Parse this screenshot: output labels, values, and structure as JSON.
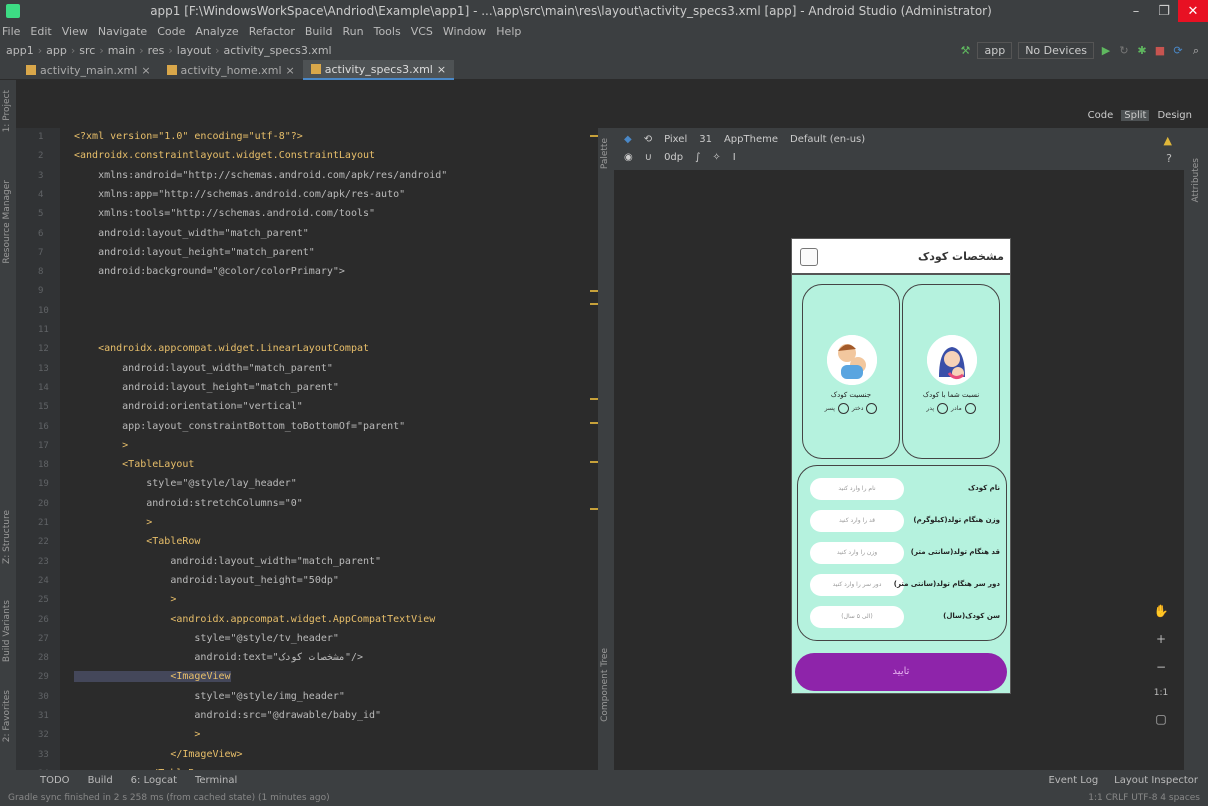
{
  "window": {
    "title": "app1 [F:\\WindowsWorkSpace\\Andriod\\Example\\app1] - ...\\app\\src\\main\\res\\layout\\activity_specs3.xml [app] - Android Studio (Administrator)",
    "minimize": "–",
    "maximize": "❐",
    "close": "✕"
  },
  "menu": [
    "File",
    "Edit",
    "View",
    "Navigate",
    "Code",
    "Analyze",
    "Refactor",
    "Build",
    "Run",
    "Tools",
    "VCS",
    "Window",
    "Help"
  ],
  "breadcrumbs": [
    "app1",
    "app",
    "src",
    "main",
    "res",
    "layout",
    "activity_specs3.xml"
  ],
  "run": {
    "config": "app",
    "device": "No Devices"
  },
  "tabs": [
    "activity_main.xml",
    "activity_home.xml",
    "activity_specs3.xml"
  ],
  "viewmode": {
    "code": "Code",
    "split": "Split",
    "design": "Design"
  },
  "designer": {
    "device": "Pixel",
    "api": "31",
    "theme": "AppTheme",
    "locale": "Default (en-us)",
    "margin": "0dp"
  },
  "sidebar": {
    "project": "1: Project",
    "resource": "Resource Manager",
    "structure": "Z: Structure",
    "variants": "Build Variants",
    "favorites": "2: Favorites",
    "palette": "Palette",
    "tree": "Component Tree",
    "attributes": "Attributes"
  },
  "code_lines": [
    "<?xml version=\"1.0\" encoding=\"utf-8\"?>",
    "<androidx.constraintlayout.widget.ConstraintLayout",
    "    xmlns:android=\"http://schemas.android.com/apk/res/android\"",
    "    xmlns:app=\"http://schemas.android.com/apk/res-auto\"",
    "    xmlns:tools=\"http://schemas.android.com/tools\"",
    "    android:layout_width=\"match_parent\"",
    "    android:layout_height=\"match_parent\"",
    "    android:background=\"@color/colorPrimary\">",
    "",
    "",
    "",
    "    <androidx.appcompat.widget.LinearLayoutCompat",
    "        android:layout_width=\"match_parent\"",
    "        android:layout_height=\"match_parent\"",
    "        android:orientation=\"vertical\"",
    "        app:layout_constraintBottom_toBottomOf=\"parent\"",
    "        >",
    "        <TableLayout",
    "            style=\"@style/lay_header\"",
    "            android:stretchColumns=\"0\"",
    "            >",
    "            <TableRow",
    "                android:layout_width=\"match_parent\"",
    "                android:layout_height=\"50dp\"",
    "                >",
    "                <androidx.appcompat.widget.AppCompatTextView",
    "                    style=\"@style/tv_header\"",
    "                    android:text=\"مشخصات کودک\"/>",
    "                <ImageView",
    "                    style=\"@style/img_header\"",
    "                    android:src=\"@drawable/baby_id\"",
    "                    >",
    "                </ImageView>",
    "            </TableRow>"
  ],
  "phone": {
    "header": "مشخصات کودک",
    "card_right": {
      "label": "نسبت شما با کودک",
      "opt1": "مادر",
      "opt2": "پدر"
    },
    "card_left": {
      "label": "جنسیت کودک",
      "opt1": "دختر",
      "opt2": "پسر"
    },
    "rows": [
      {
        "label": "نام کودک",
        "hint": "نام را وارد کنید"
      },
      {
        "label": "(کیلوگرم)وزن هنگام تولد",
        "hint": "قد را وارد کنید"
      },
      {
        "label": "(سانتی متر)قد هنگام تولد",
        "hint": "وزن را وارد کنید"
      },
      {
        "label": "(سانتی متر)دور سر هنگام تولد",
        "hint": "دور سر را وارد کنید"
      },
      {
        "label": "(سال)سن کودک",
        "hint": "(الی ۵ سال)"
      }
    ],
    "submit": "تایید"
  },
  "bottom": {
    "todo": "TODO",
    "build": "Build",
    "logcat": "6: Logcat",
    "terminal": "Terminal",
    "eventlog": "Event Log",
    "inspector": "Layout Inspector"
  },
  "status": {
    "message": "Gradle sync finished in 2 s 258 ms (from cached state) (1 minutes ago)",
    "right": "1:1  CRLF  UTF-8  4 spaces"
  },
  "zoom": {
    "ratio": "1:1"
  }
}
